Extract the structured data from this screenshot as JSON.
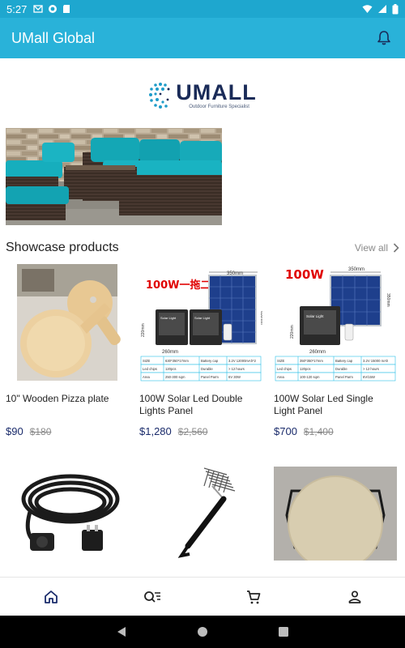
{
  "status_bar": {
    "time": "5:27"
  },
  "app_bar": {
    "title": "UMall Global",
    "notification_icon": "bell-icon"
  },
  "logo": {
    "word": "UMALL",
    "tagline": "Outdoor Furniture Specialist"
  },
  "banner": {
    "alt": "banner-image"
  },
  "showcase": {
    "title": "Showcase products",
    "view_all": "View all",
    "products": [
      {
        "name": "10\" Wooden Pizza plate",
        "price": "$90",
        "original_price": "$180"
      },
      {
        "name": "100W Solar Led Double Lights Panel",
        "price": "$1,280",
        "original_price": "$2,560",
        "badge": "100W一拖二"
      },
      {
        "name": "100W Solar Led Single Light Panel",
        "price": "$700",
        "original_price": "$1,400",
        "badge": "100W"
      },
      {
        "name": "",
        "price": "",
        "original_price": ""
      },
      {
        "name": "",
        "price": "",
        "original_price": ""
      },
      {
        "name": "",
        "price": "",
        "original_price": ""
      }
    ]
  },
  "solar_text": {
    "dim_top": "350mm",
    "dim_side": "220mm",
    "dim_bottom": "260mm",
    "dim_right_double": "630mm",
    "dim_right_single": "350mm",
    "light_label": "Solar Light",
    "table_double": [
      [
        "SIZE",
        "630*350*17mm",
        "Battery cap",
        "3.2V 12000mAh*2"
      ],
      [
        "Led chips",
        "120pcs",
        "Durable",
        "> 12 hours"
      ],
      [
        "Area",
        "250-300 sqm",
        "Panel Parm",
        "6V 30W"
      ]
    ],
    "table_single": [
      [
        "SIZE",
        "350*350*17mm",
        "Battery cap",
        "3.2V 15000 mAh"
      ],
      [
        "Led chips",
        "120pcs",
        "Durable",
        "> 12 hours"
      ],
      [
        "Area",
        "100-120 sqm",
        "Panel Parm",
        "6V/15W"
      ]
    ]
  },
  "bottom_nav": [
    {
      "name": "nav-home",
      "icon": "home-icon"
    },
    {
      "name": "nav-search",
      "icon": "search-list-icon"
    },
    {
      "name": "nav-cart",
      "icon": "cart-icon"
    },
    {
      "name": "nav-account",
      "icon": "person-icon"
    }
  ],
  "colors": {
    "app_bar": "#29b2d9",
    "status_bar": "#1ea7cf",
    "price": "#1a2b6b",
    "badge": "#e00000"
  }
}
